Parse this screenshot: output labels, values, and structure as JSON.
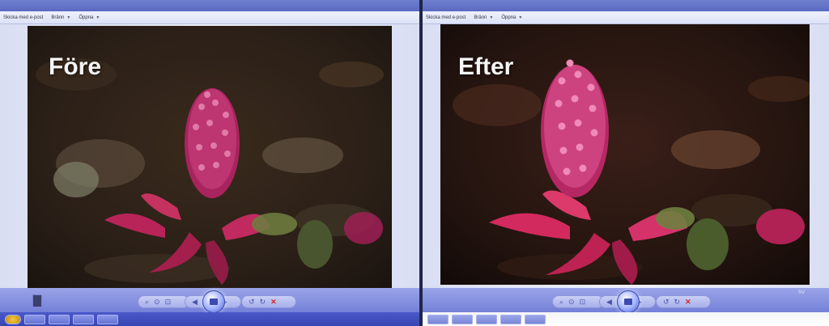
{
  "comparison": {
    "before_label": "Före",
    "after_label": "Efter"
  },
  "left_window": {
    "title": "",
    "toolbar": {
      "email_label": "Skicka med e-post",
      "burn_label": "Bränn",
      "open_label": "Öppna"
    }
  },
  "right_window": {
    "title": "",
    "toolbar": {
      "email_label": "Skicka med e-post",
      "burn_label": "Bränn",
      "open_label": "Öppna"
    }
  },
  "taskbar": {
    "language": "SV"
  },
  "colors": {
    "window_chrome": "#6f7fcf",
    "toolbar_bg": "#e6e9f8",
    "control_bar": "#8a94e0",
    "delete_icon": "#d8262a",
    "flower": "#c42a6a"
  }
}
